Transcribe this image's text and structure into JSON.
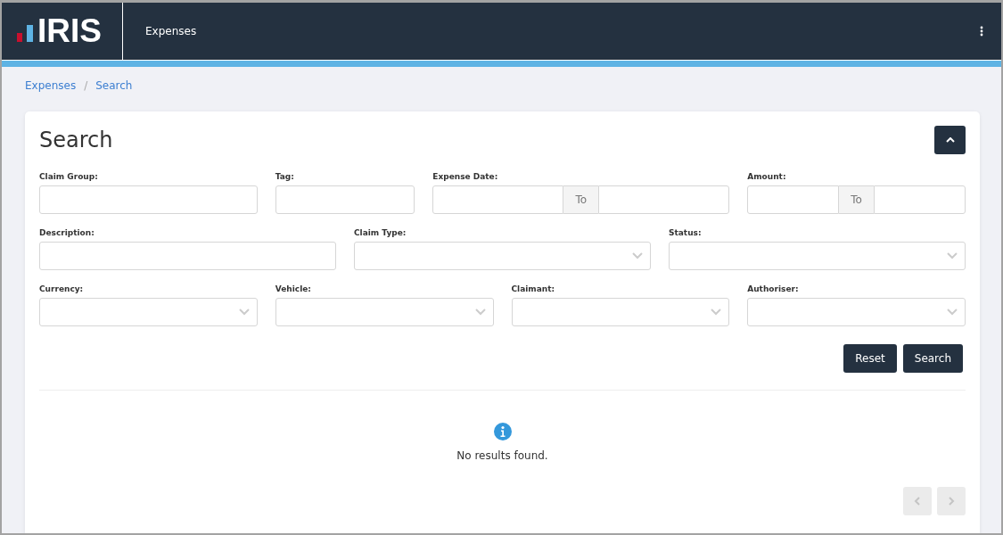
{
  "header": {
    "logo": "IRIS",
    "app_title": "Expenses"
  },
  "breadcrumb": {
    "separator": "/",
    "items": [
      {
        "label": "Expenses"
      },
      {
        "label": "Search"
      }
    ]
  },
  "search_panel": {
    "title": "Search",
    "expanded": true,
    "rows": [
      [
        {
          "kind": "text",
          "label": "Claim Group:"
        },
        {
          "kind": "text",
          "label": "Tag:"
        },
        {
          "kind": "range",
          "label": "Expense Date:",
          "separator": "To"
        },
        {
          "kind": "range",
          "label": "Amount:",
          "separator": "To"
        }
      ],
      [
        {
          "kind": "text",
          "label": "Description:"
        },
        {
          "kind": "select",
          "label": "Claim Type:"
        },
        {
          "kind": "select",
          "label": "Status:"
        }
      ],
      [
        {
          "kind": "select",
          "label": "Currency:"
        },
        {
          "kind": "select",
          "label": "Vehicle:"
        },
        {
          "kind": "select",
          "label": "Claimant:"
        },
        {
          "kind": "select",
          "label": "Authoriser:"
        }
      ]
    ],
    "buttons": [
      {
        "label": "Reset"
      },
      {
        "label": "Search"
      }
    ]
  },
  "results": {
    "message": "No results found.",
    "pagination": {
      "previous_disabled": true,
      "next_disabled": true
    }
  }
}
